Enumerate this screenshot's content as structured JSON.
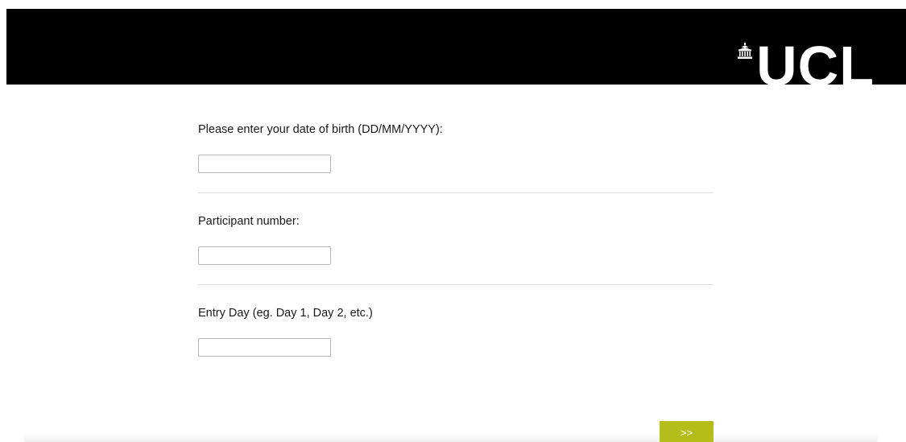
{
  "header": {
    "logo_text": "UCL",
    "logo_icon": "portico-icon",
    "background_color": "#000000"
  },
  "questions": [
    {
      "label": "Please enter your date of birth (DD/MM/YYYY):",
      "value": ""
    },
    {
      "label": "Participant number:",
      "value": ""
    },
    {
      "label": "Entry Day (eg. Day 1, Day 2, etc.)",
      "value": ""
    }
  ],
  "navigation": {
    "next_label": ">>",
    "next_color": "#b5bd1a"
  }
}
